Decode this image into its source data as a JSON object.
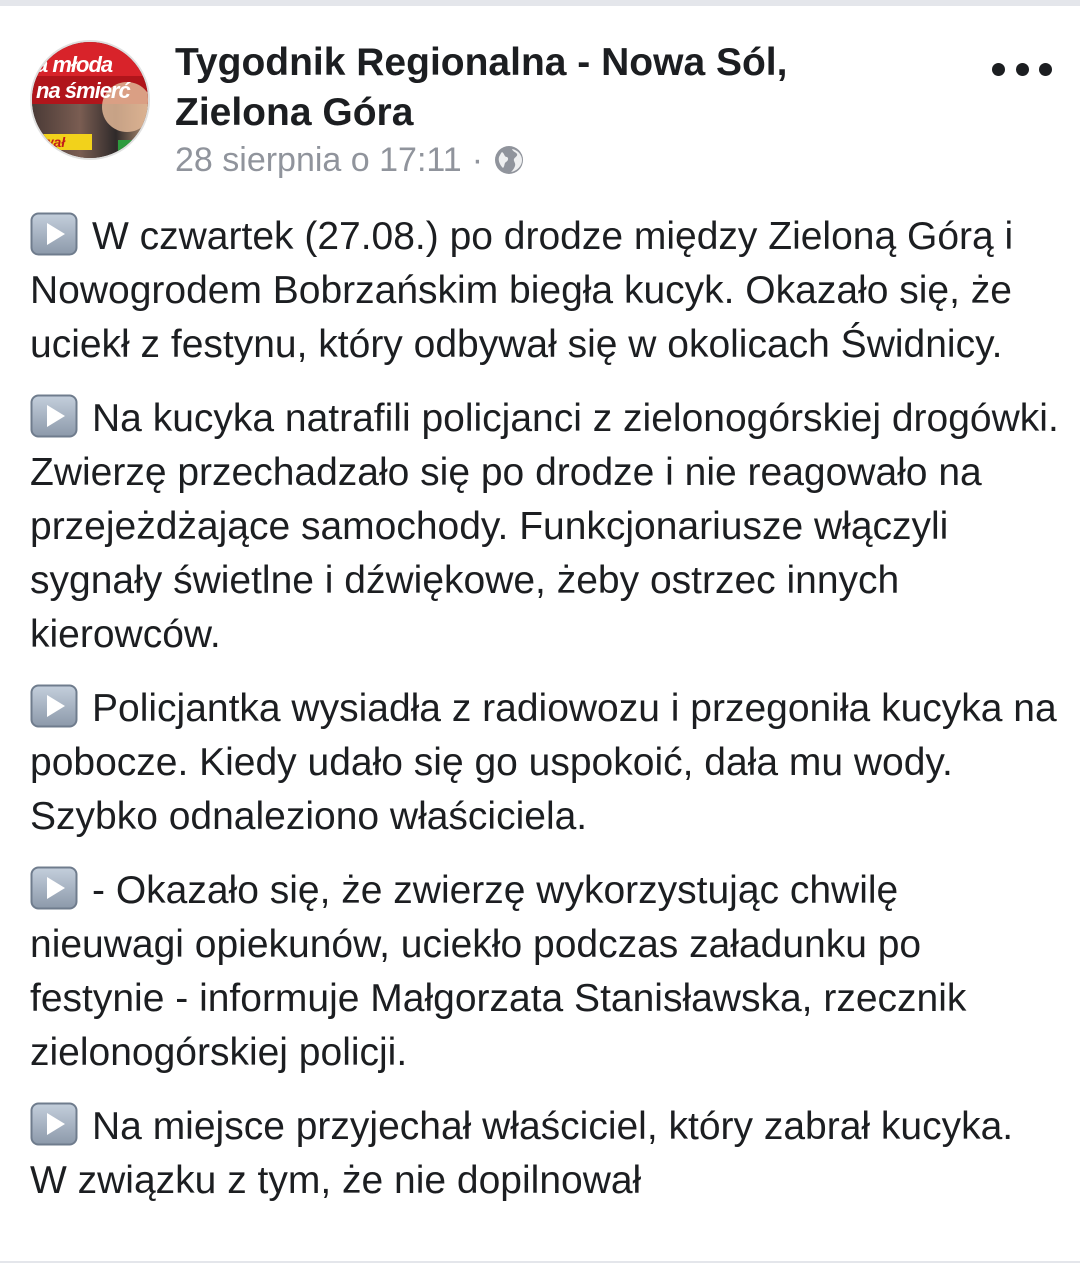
{
  "post": {
    "page_name": "Tygodnik Regionalna - Nowa Sól, Zielona Góra",
    "timestamp": "28 sierpnia o 17:11",
    "separator": "·",
    "privacy_icon": "globe-icon",
    "more_icon": "more-options-icon",
    "avatar_text": {
      "line1": "a młoda",
      "line2": "na śmierć",
      "line3": "uwał"
    },
    "paragraph_icon": "play-button-icon",
    "paragraphs": [
      "W czwartek (27.08.) po drodze między Zieloną Górą i Nowogrodem Bobrzańskim biegła kucyk. Okazało się, że uciekł z festynu, który odbywał się w okolicach Świdnicy.",
      "Na kucyka natrafili policjanci z zielonogórskiej drogówki. Zwierzę przechadzało się po drodze i nie reagowało na przejeżdżające samochody. Funkcjonariusze włączyli sygnały świetlne i dźwiękowe, żeby ostrzec innych kierowców.",
      "Policjantka wysiadła z radiowozu i przegoniła kucyka na pobocze. Kiedy udało się go uspokoić, dała mu wody. Szybko odnaleziono właściciela.",
      "- Okazało się, że zwierzę wykorzystując chwilę nieuwagi opiekunów, uciekło podczas załadunku po festynie - informuje Małgorzata Stanisławska, rzecznik zielonogórskiej policji.",
      "Na miejsce przyjechał właściciel, który zabrał kucyka. W związku z tym, że nie dopilnował"
    ]
  },
  "colors": {
    "text": "#1c1e21",
    "meta": "#90949c",
    "divider": "#e4e6eb",
    "icon_button_fill": "#9aa7b8"
  }
}
